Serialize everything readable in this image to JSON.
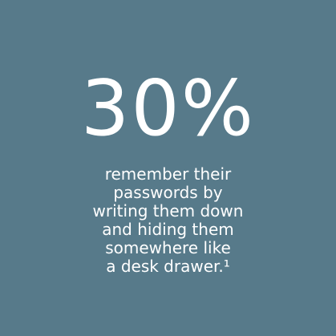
{
  "stat": {
    "value": "30%"
  },
  "caption": {
    "lines": [
      "remember their",
      "passwords by",
      "writing them down",
      "and hiding them",
      "somewhere like",
      "a desk drawer.¹"
    ]
  },
  "colors": {
    "background": "#577a8a",
    "text": "#ffffff"
  }
}
